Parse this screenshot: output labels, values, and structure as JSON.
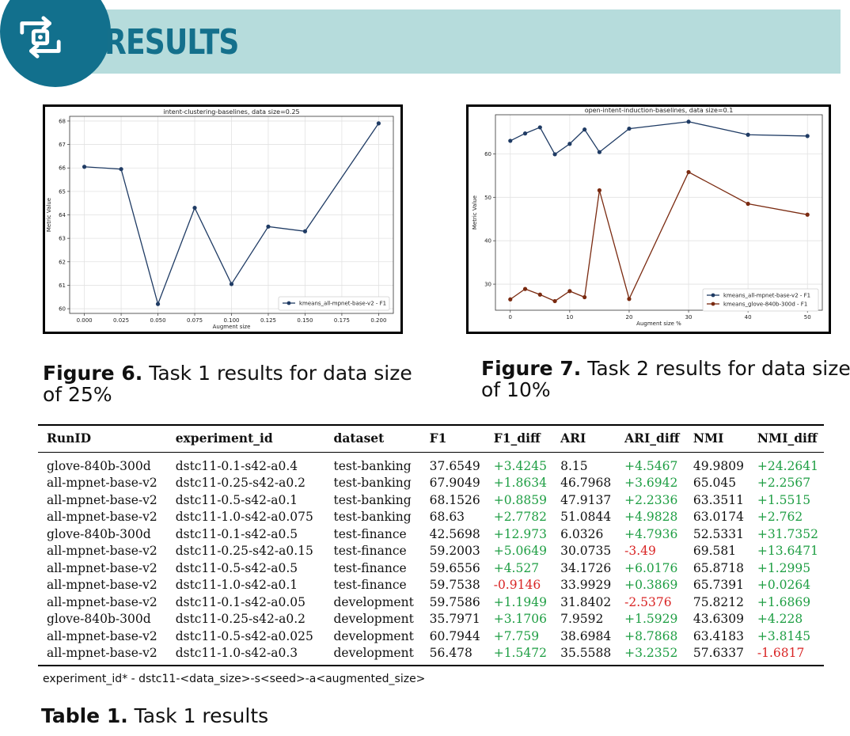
{
  "header": {
    "title": "RESULTS",
    "logo_icon": "sync-arrows-icon",
    "brand_color": "#12708d",
    "banner_color": "#b6dcdc"
  },
  "figures": [
    {
      "label": "Figure 6.",
      "caption": "Task 1 results for data size of 25%"
    },
    {
      "label": "Figure 7.",
      "caption": "Task 2 results for data size of 10%"
    }
  ],
  "chart_data": [
    {
      "type": "line",
      "title": "intent-clustering-baselines, data size=0.25",
      "xlabel": "Augment size",
      "ylabel": "Metric Value",
      "xlim": [
        -0.01,
        0.21
      ],
      "ylim": [
        59.8,
        68.2
      ],
      "xticks": [
        "0.000",
        "0.025",
        "0.050",
        "0.075",
        "0.100",
        "0.125",
        "0.150",
        "0.175",
        "0.200"
      ],
      "xtick_values": [
        0,
        0.025,
        0.05,
        0.075,
        0.1,
        0.125,
        0.15,
        0.175,
        0.2
      ],
      "yticks": [
        60,
        61,
        62,
        63,
        64,
        65,
        66,
        67,
        68
      ],
      "grid": true,
      "legend_position": "lower-right",
      "series": [
        {
          "name": "kmeans_all-mpnet-base-v2 - F1",
          "color": "#1f3b64",
          "x": [
            0,
            0.025,
            0.05,
            0.075,
            0.1,
            0.125,
            0.15,
            0.2
          ],
          "y": [
            66.05,
            65.95,
            60.2,
            64.3,
            61.05,
            63.5,
            63.3,
            67.9
          ]
        }
      ]
    },
    {
      "type": "line",
      "title": "open-intent-induction-baselines, data size=0.1",
      "xlabel": "Augment size %",
      "ylabel": "Metric Value",
      "xlim": [
        -2.5,
        52.5
      ],
      "ylim": [
        24,
        69
      ],
      "xticks": [
        "0",
        "10",
        "20",
        "30",
        "40",
        "50"
      ],
      "xtick_values": [
        0,
        10,
        20,
        30,
        40,
        50
      ],
      "yticks": [
        30,
        40,
        50,
        60
      ],
      "grid": true,
      "legend_position": "lower-right",
      "series": [
        {
          "name": "kmeans_all-mpnet-base-v2 - F1",
          "color": "#1f3b64",
          "x": [
            0,
            2.5,
            5,
            7.5,
            10,
            12.5,
            15,
            20,
            30,
            40,
            50
          ],
          "y": [
            63,
            64.7,
            66.1,
            59.9,
            62.3,
            65.6,
            60.4,
            65.8,
            67.4,
            64.4,
            64.1
          ]
        },
        {
          "name": "kmeans_glove-840b-300d - F1",
          "color": "#7a2a10",
          "x": [
            0,
            2.5,
            5,
            7.5,
            10,
            12.5,
            15,
            20,
            30,
            40,
            50
          ],
          "y": [
            26.5,
            28.9,
            27.6,
            26.1,
            28.4,
            27,
            51.6,
            26.6,
            55.8,
            48.5,
            46
          ]
        }
      ]
    }
  ],
  "table": {
    "columns": [
      "RunID",
      "experiment_id",
      "dataset",
      "F1",
      "F1_diff",
      "ARI",
      "ARI_diff",
      "NMI",
      "NMI_diff"
    ],
    "rows": [
      [
        "glove-840b-300d",
        "dstc11-0.1-s42-a0.4",
        "test-banking",
        "37.6549",
        "+3.4245",
        "8.15",
        "+4.5467",
        "49.9809",
        "+24.2641"
      ],
      [
        "all-mpnet-base-v2",
        "dstc11-0.25-s42-a0.2",
        "test-banking",
        "67.9049",
        "+1.8634",
        "46.7968",
        "+3.6942",
        "65.045",
        "+2.2567"
      ],
      [
        "all-mpnet-base-v2",
        "dstc11-0.5-s42-a0.1",
        "test-banking",
        "68.1526",
        "+0.8859",
        "47.9137",
        "+2.2336",
        "63.3511",
        "+1.5515"
      ],
      [
        "all-mpnet-base-v2",
        "dstc11-1.0-s42-a0.075",
        "test-banking",
        "68.63",
        "+2.7782",
        "51.0844",
        "+4.9828",
        "63.0174",
        "+2.762"
      ],
      [
        "glove-840b-300d",
        "dstc11-0.1-s42-a0.5",
        "test-finance",
        "42.5698",
        "+12.973",
        "6.0326",
        "+4.7936",
        "52.5331",
        "+31.7352"
      ],
      [
        "all-mpnet-base-v2",
        "dstc11-0.25-s42-a0.15",
        "test-finance",
        "59.2003",
        "+5.0649",
        "30.0735",
        "-3.49",
        "69.581",
        "+13.6471"
      ],
      [
        "all-mpnet-base-v2",
        "dstc11-0.5-s42-a0.5",
        "test-finance",
        "59.6556",
        "+4.527",
        "34.1726",
        "+6.0176",
        "65.8718",
        "+1.2995"
      ],
      [
        "all-mpnet-base-v2",
        "dstc11-1.0-s42-a0.1",
        "test-finance",
        "59.7538",
        "-0.9146",
        "33.9929",
        "+0.3869",
        "65.7391",
        "+0.0264"
      ],
      [
        "all-mpnet-base-v2",
        "dstc11-0.1-s42-a0.05",
        "development",
        "59.7586",
        "+1.1949",
        "31.8402",
        "-2.5376",
        "75.8212",
        "+1.6869"
      ],
      [
        "glove-840b-300d",
        "dstc11-0.25-s42-a0.2",
        "development",
        "35.7971",
        "+3.1706",
        "7.9592",
        "+1.5929",
        "43.6309",
        "+4.228"
      ],
      [
        "all-mpnet-base-v2",
        "dstc11-0.5-s42-a0.025",
        "development",
        "60.7944",
        "+7.759",
        "38.6984",
        "+8.7868",
        "63.4183",
        "+3.8145"
      ],
      [
        "all-mpnet-base-v2",
        "dstc11-1.0-s42-a0.3",
        "development",
        "56.478",
        "+1.5472",
        "35.5588",
        "+3.2352",
        "57.6337",
        "-1.6817"
      ]
    ],
    "positive_color": "#1e9e43",
    "negative_color": "#d92525",
    "footnote": "experiment_id* - dstc11-<data_size>-s<seed>-a<augmented_size>",
    "caption_label": "Table 1.",
    "caption": "Task 1 results"
  }
}
